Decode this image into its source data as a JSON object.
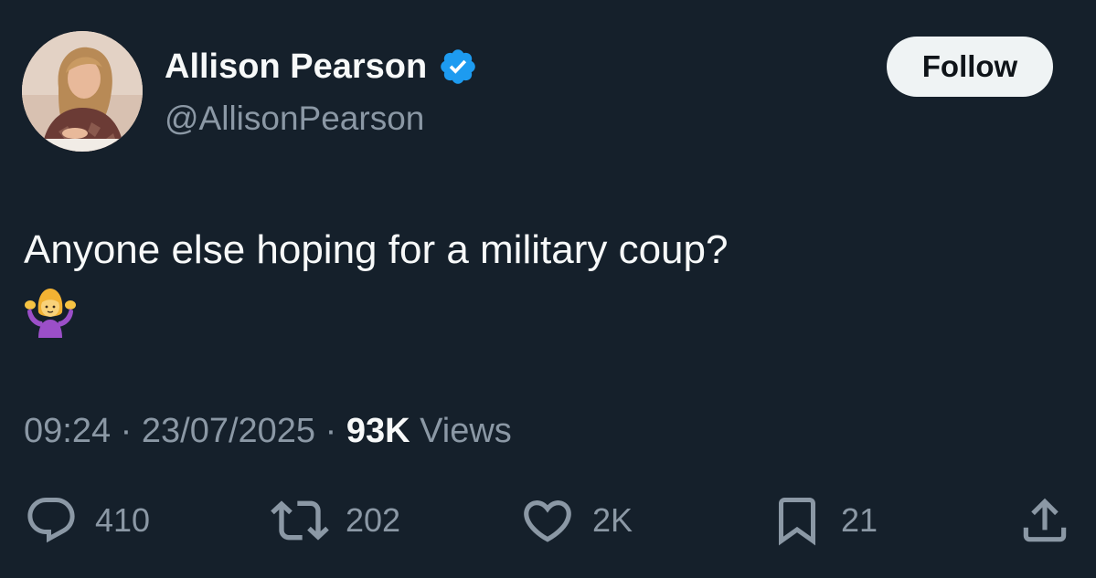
{
  "author": {
    "display_name": "Allison Pearson",
    "handle": "@AllisonPearson",
    "verified": true,
    "avatar": "profile-photo"
  },
  "follow_button": {
    "label": "Follow"
  },
  "tweet": {
    "text": "Anyone else hoping for a military coup?",
    "emoji": "🤷‍♀️",
    "time": "09:24",
    "date": "23/07/2025",
    "views_count": "93K",
    "views_label": "Views",
    "separator": "·"
  },
  "actions": {
    "replies": {
      "icon": "reply-icon",
      "count": "410"
    },
    "reposts": {
      "icon": "repost-icon",
      "count": "202"
    },
    "likes": {
      "icon": "heart-icon",
      "count": "2K"
    },
    "bookmarks": {
      "icon": "bookmark-icon",
      "count": "21"
    },
    "share": {
      "icon": "share-icon"
    }
  },
  "colors": {
    "background": "#15202b",
    "primary_text": "#f7f9f9",
    "secondary_text": "#8b98a5",
    "verified_blue": "#1d9bf0",
    "follow_bg": "#eff3f4"
  }
}
